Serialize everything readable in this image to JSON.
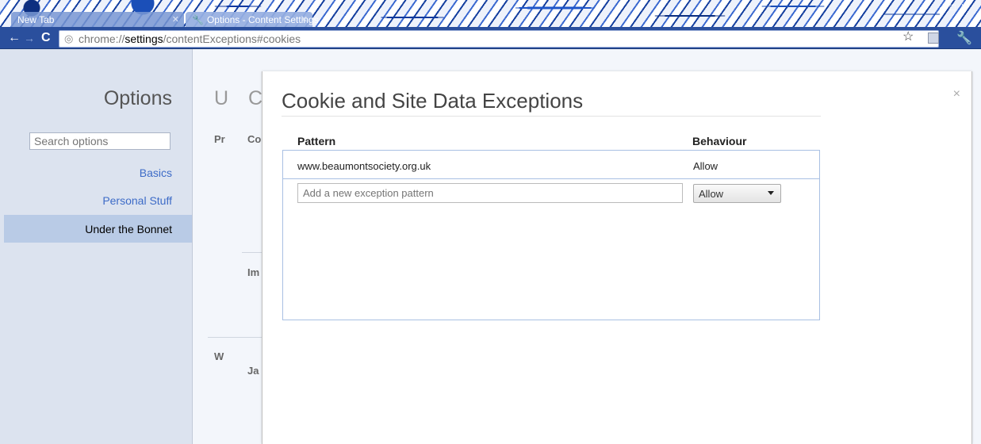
{
  "browser": {
    "tabs": [
      {
        "label": "New Tab",
        "active": false
      },
      {
        "label": "Options - Content Settings",
        "active": true
      }
    ],
    "address": {
      "scheme": "chrome://",
      "host": "settings",
      "path": "/contentExceptions#cookies"
    }
  },
  "sidebar": {
    "title": "Options",
    "search_placeholder": "Search options",
    "items": [
      {
        "label": "Basics",
        "selected": false
      },
      {
        "label": "Personal Stuff",
        "selected": false
      },
      {
        "label": "Under the Bonnet",
        "selected": true
      }
    ]
  },
  "background_page": {
    "heading_fragments": [
      "U",
      "C"
    ],
    "left_labels": [
      "Pr",
      "W"
    ],
    "right_labels": [
      "Co",
      "Im",
      "Ja"
    ]
  },
  "dialog": {
    "title": "Cookie and Site Data Exceptions",
    "close_glyph": "×",
    "columns": {
      "pattern": "Pattern",
      "behaviour": "Behaviour"
    },
    "exceptions": [
      {
        "pattern": "www.beaumontsociety.org.uk",
        "behaviour": "Allow"
      }
    ],
    "new_row": {
      "placeholder": "Add a new exception pattern",
      "selected_behaviour": "Allow"
    }
  },
  "colors": {
    "toolbar": "#2a4f9d",
    "sidebar_bg": "#dce3ef",
    "selected_nav_bg": "#b9cbe6",
    "link": "#3d6bc7",
    "list_border": "#a9c0e3"
  }
}
